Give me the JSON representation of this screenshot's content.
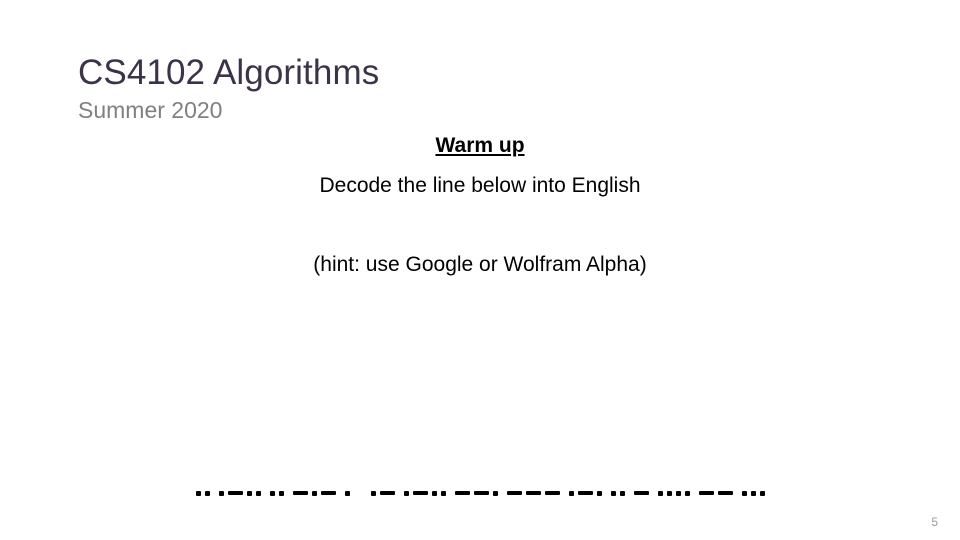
{
  "slide": {
    "title": "CS4102 Algorithms",
    "subtitle": "Summer 2020",
    "page_number": "5",
    "background_color": "#FFFFFF",
    "title_color": "#3D3349",
    "subtitle_color": "#808080",
    "body_color": "#000000",
    "page_number_color": "#9B9B9B"
  },
  "body": {
    "heading": "Warm up",
    "instruction": "Decode the line below into English",
    "hint": "(hint: use Google or Wolfram Alpha)"
  },
  "morse": {
    "plain_text": "I LIKE ALGORITHMS",
    "code_text": ".. .-.. .. -.- .  .- .-.. --. --- .-. .. - .... -- ...",
    "words": [
      {
        "word": "I LIKE",
        "letters": [
          {
            "char": "I",
            "code": ".."
          },
          {
            "char": "L",
            "code": ".-.."
          },
          {
            "char": "I",
            "code": ".."
          },
          {
            "char": "K",
            "code": "-.-"
          },
          {
            "char": "E",
            "code": "."
          }
        ]
      },
      {
        "word": "ALGORITHMS",
        "letters": [
          {
            "char": "A",
            "code": ".-"
          },
          {
            "char": "L",
            "code": ".-.."
          },
          {
            "char": "G",
            "code": "--."
          },
          {
            "char": "O",
            "code": "---"
          },
          {
            "char": "R",
            "code": ".-."
          },
          {
            "char": "I",
            "code": ".."
          },
          {
            "char": "T",
            "code": "-"
          },
          {
            "char": "H",
            "code": "...."
          },
          {
            "char": "M",
            "code": "--"
          },
          {
            "char": "S",
            "code": "..."
          }
        ]
      }
    ]
  }
}
